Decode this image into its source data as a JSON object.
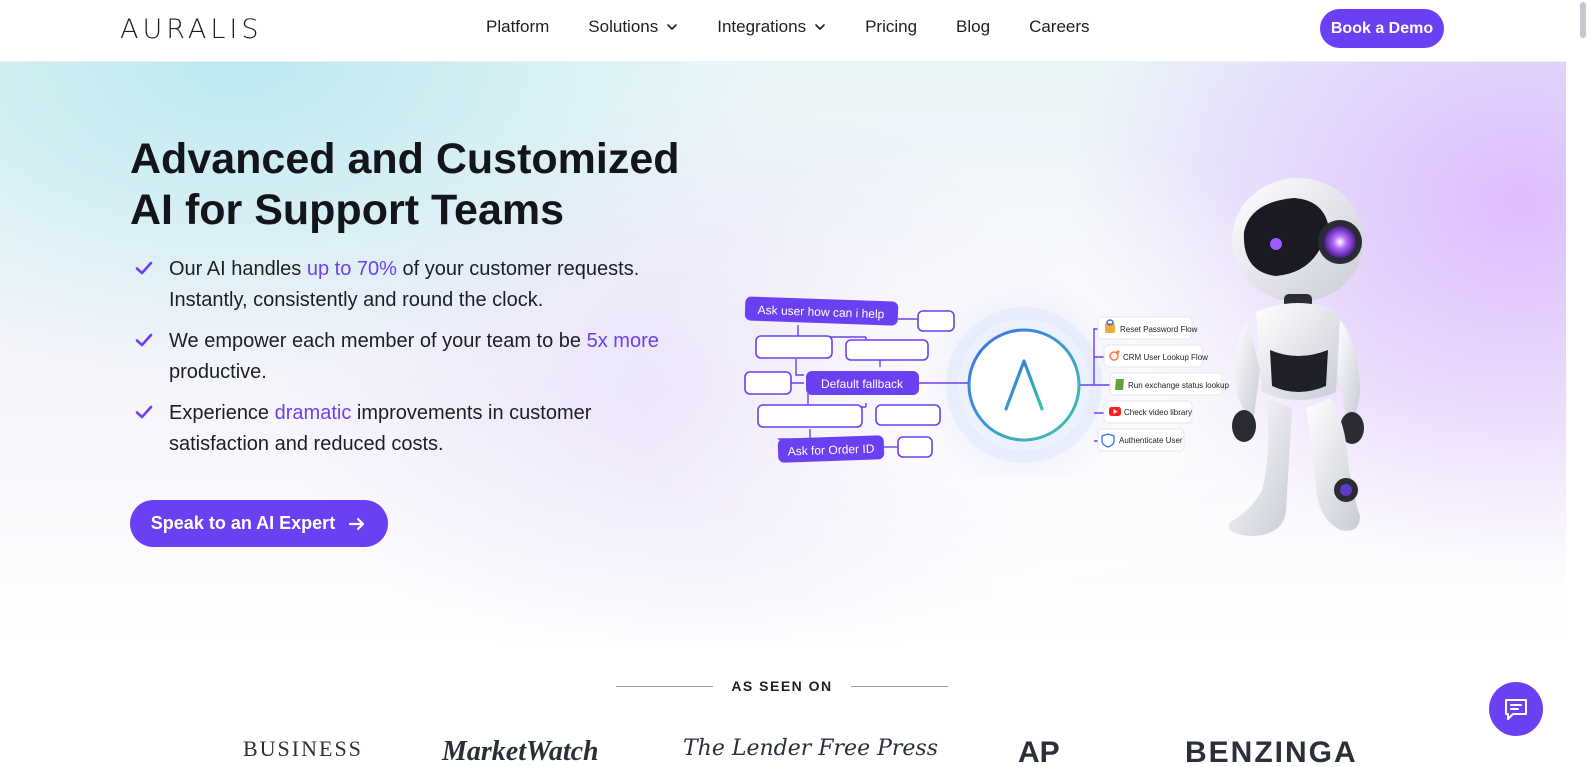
{
  "brand": {
    "logo": "AURALIS"
  },
  "nav": {
    "items": [
      {
        "label": "Platform",
        "has_dropdown": false
      },
      {
        "label": "Solutions",
        "has_dropdown": true
      },
      {
        "label": "Integrations",
        "has_dropdown": true
      },
      {
        "label": "Pricing",
        "has_dropdown": false
      },
      {
        "label": "Blog",
        "has_dropdown": false
      },
      {
        "label": "Careers",
        "has_dropdown": false
      }
    ],
    "cta": "Book a Demo"
  },
  "hero": {
    "title_line1": "Advanced and Customized",
    "title_line2": "AI for Support Teams",
    "features": [
      {
        "before": "Our AI handles ",
        "highlight": "up to 70%",
        "after": " of your customer requests. Instantly, consistently and round the clock."
      },
      {
        "before": "We empower each member of your team to be ",
        "highlight": "5x more",
        "after": " productive."
      },
      {
        "before": "Experience ",
        "highlight": "dramatic",
        "after": " improvements in customer satisfaction and reduced costs."
      }
    ],
    "cta": "Speak to an AI Expert"
  },
  "diagram": {
    "nodes": {
      "ask_help": "Ask user how can i help",
      "fallback": "Default fallback",
      "order_id": "Ask for Order ID"
    },
    "integrations": [
      {
        "label": "Reset Password Flow",
        "icon": "lock-icon"
      },
      {
        "label": "CRM User Lookup Flow",
        "icon": "hubspot-icon"
      },
      {
        "label": "Run exchange status lookup",
        "icon": "shopify-icon"
      },
      {
        "label": "Check video library",
        "icon": "youtube-icon"
      },
      {
        "label": "Authenticate User",
        "icon": "shield-icon"
      }
    ]
  },
  "press": {
    "heading": "AS SEEN ON",
    "logos": [
      "BUSINESS",
      "MarketWatch",
      "The Lender Free Press",
      "AP",
      "BENZINGA"
    ]
  },
  "colors": {
    "accent": "#6b3ff2",
    "text": "#13151b"
  }
}
